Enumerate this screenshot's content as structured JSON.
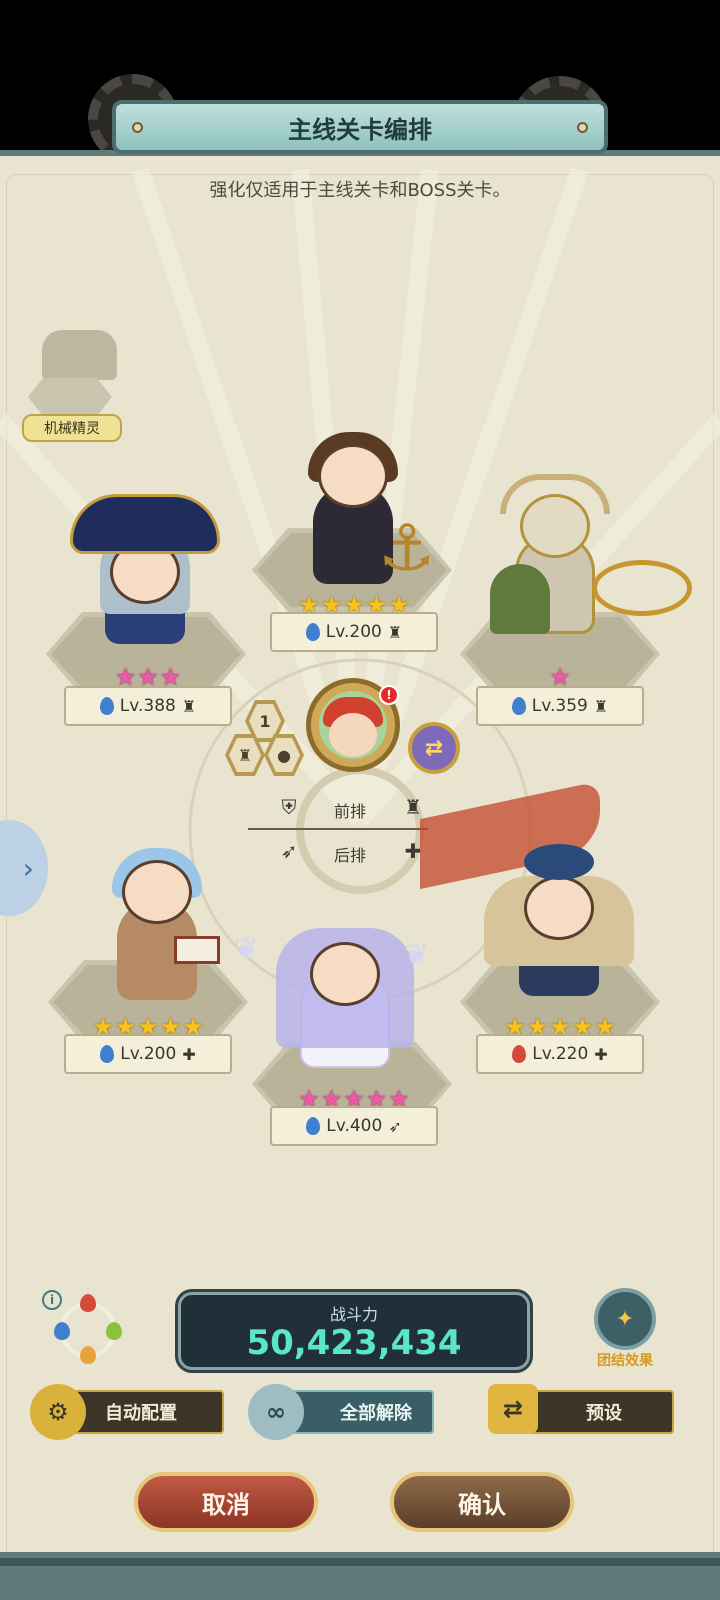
{
  "title": "主线关卡编排",
  "subtitle": "强化仅适用于主线关卡和BOSS关卡。",
  "elf": {
    "label": "机械精灵"
  },
  "heroes": [
    {
      "id": "witch",
      "level": "Lv.388",
      "stars": 3,
      "star_color": "pink",
      "element": "water",
      "role": "front"
    },
    {
      "id": "pirate",
      "level": "Lv.200",
      "stars": 5,
      "star_color": "gold",
      "element": "water",
      "role": "front"
    },
    {
      "id": "knight",
      "level": "Lv.359",
      "stars": 1,
      "star_color": "pink",
      "element": "water",
      "role": "front"
    },
    {
      "id": "scholar",
      "level": "Lv.200",
      "stars": 5,
      "star_color": "gold",
      "element": "water",
      "role": "support"
    },
    {
      "id": "bride",
      "level": "Lv.400",
      "stars": 5,
      "star_color": "pink",
      "element": "water",
      "role": "back"
    },
    {
      "id": "flagbearer",
      "level": "Lv.220",
      "stars": 5,
      "star_color": "gold",
      "element": "fire",
      "role": "support"
    }
  ],
  "formation": {
    "slot_number": "1",
    "leader_badge": "!",
    "front_label": "前排",
    "back_label": "后排"
  },
  "power": {
    "label": "战斗力",
    "value": "50,423,434"
  },
  "unity_label": "团结效果",
  "buttons": {
    "auto": "自动配置",
    "clear_all": "全部解除",
    "preset": "预设",
    "cancel": "取消",
    "confirm": "确认"
  },
  "colors": {
    "panel_bg": "#e8e4cf",
    "title_bar": "#8fc2bd",
    "power_value": "#59e6c9",
    "cancel_button": "#a8412f",
    "confirm_button": "#6f5136",
    "star_gold": "#f7c31c",
    "star_pink": "#ec5aa6"
  }
}
